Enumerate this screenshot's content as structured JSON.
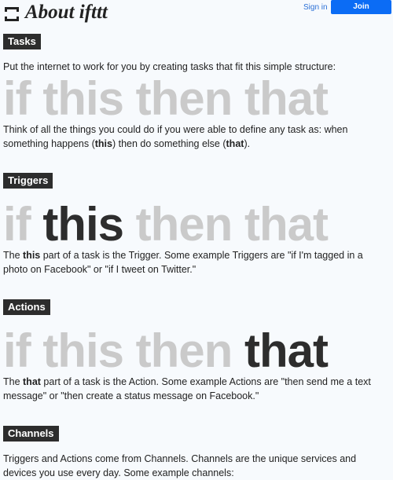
{
  "header": {
    "brand": "About ifttt",
    "signin": "Sign in",
    "join": "Join"
  },
  "tasks": {
    "label": "Tasks",
    "intro": "Put the internet to work for you by creating tasks that fit this simple structure:",
    "formula": {
      "w1": "if",
      "w2": "this",
      "w3": "then",
      "w4": "that"
    },
    "desc": {
      "t1": "Think of all the things you could do if you were able to define any task as: when something happens (",
      "b1": "this",
      "t2": ") then do something else (",
      "b2": "that",
      "t3": ")."
    }
  },
  "triggers": {
    "label": "Triggers",
    "formula": {
      "w1": "if",
      "w2": "this",
      "w3": "then",
      "w4": "that"
    },
    "desc": {
      "t1": "The ",
      "b1": "this",
      "t2": " part of a task is the Trigger. Some example Triggers are \"if I'm tagged in a photo on Facebook\" or \"if I tweet on Twitter.\""
    }
  },
  "actions": {
    "label": "Actions",
    "formula": {
      "w1": "if",
      "w2": "this",
      "w3": "then",
      "w4": "that"
    },
    "desc": {
      "t1": "The ",
      "b1": "that",
      "t2": " part of a task is the Action. Some example Actions are \"then send me a text message\" or \"then create a status message on Facebook.\""
    }
  },
  "channels": {
    "label": "Channels",
    "desc": "Triggers and Actions come from Channels. Channels are the unique services and devices you use every day. Some example channels:"
  },
  "colors": {
    "muted_word": "#cacaca",
    "highlight_word": "#2d2d2d",
    "label_bg": "#2d2d2d",
    "join_bg": "#0b6cf5",
    "link": "#2a6fd6"
  }
}
